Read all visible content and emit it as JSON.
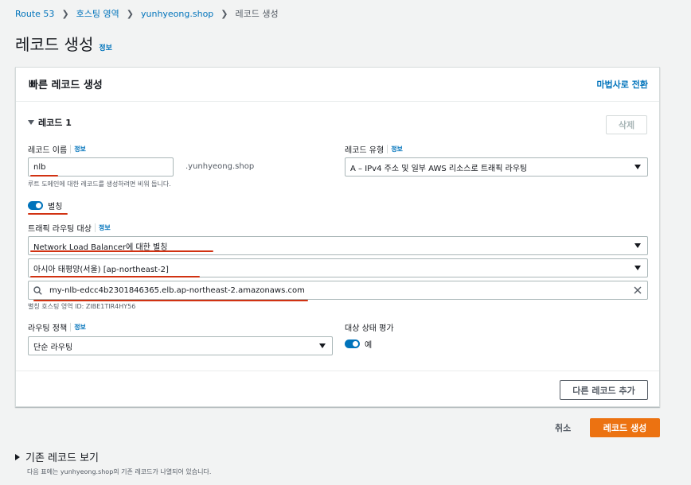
{
  "breadcrumb": {
    "items": [
      "Route 53",
      "호스팅 영역",
      "yunhyeong.shop"
    ],
    "current": "레코드 생성"
  },
  "page": {
    "title": "레코드 생성",
    "info": "정보"
  },
  "card": {
    "title": "빠른 레코드 생성",
    "wizard_link": "마법사로 전환",
    "record_header": "레코드 1",
    "delete_label": "삭제",
    "record_name": {
      "label": "레코드 이름",
      "info": "정보",
      "value": "nlb",
      "suffix": ".yunhyeong.shop",
      "hint": "루트 도메인에 대한 레코드를 생성하려면 비워 둡니다."
    },
    "record_type": {
      "label": "레코드 유형",
      "info": "정보",
      "value": "A – IPv4 주소 및 일부 AWS 리소스로 트래픽 라우팅"
    },
    "alias": {
      "label": "별칭",
      "enabled": true
    },
    "traffic_target": {
      "label": "트래픽 라우팅 대상",
      "info": "정보",
      "endpoint": "Network Load Balancer에 대한 별칭",
      "region": "아시아 태평양(서울) [ap-northeast-2]",
      "search_value": "my-nlb-edcc4b2301846365.elb.ap-northeast-2.amazonaws.com",
      "hosted_zone_hint": "별칭 호스팅 영역 ID: ZIBE1TIR4HY56"
    },
    "routing_policy": {
      "label": "라우팅 정책",
      "info": "정보",
      "value": "단순 라우팅"
    },
    "health": {
      "label": "대상 상태 평가",
      "toggle_label": "예",
      "enabled": true
    },
    "add_record_label": "다른 레코드 추가"
  },
  "actions": {
    "cancel": "취소",
    "create": "레코드 생성"
  },
  "existing": {
    "title": "기존 레코드 보기",
    "description": "다음 표에는 yunhyeong.shop의 기존 레코드가 나열되어 있습니다."
  },
  "colors": {
    "accent": "#0073bb",
    "primary": "#ec7211",
    "annotation": "#d13212"
  }
}
